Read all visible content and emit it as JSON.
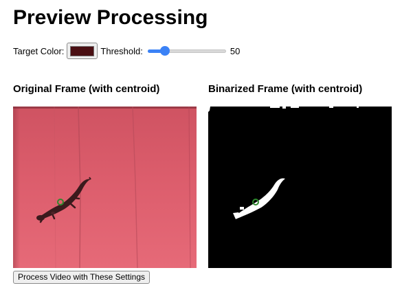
{
  "page": {
    "title": "Preview Processing"
  },
  "controls": {
    "target_color_label": "Target Color:",
    "target_color_value": "#4a0f13",
    "threshold_label": "Threshold:",
    "threshold_value": "50",
    "threshold_fraction": 0.22
  },
  "original_frame": {
    "title": "Original Frame (with centroid)",
    "background_color": "#da5c6b",
    "centroid_color": "#2e8b2e"
  },
  "binarized_frame": {
    "title": "Binarized Frame (with centroid)",
    "foreground_color": "#ffffff",
    "background_color": "#000000",
    "centroid_color": "#2e8b2e"
  },
  "actions": {
    "process_button_label": "Process Video with These Settings"
  }
}
